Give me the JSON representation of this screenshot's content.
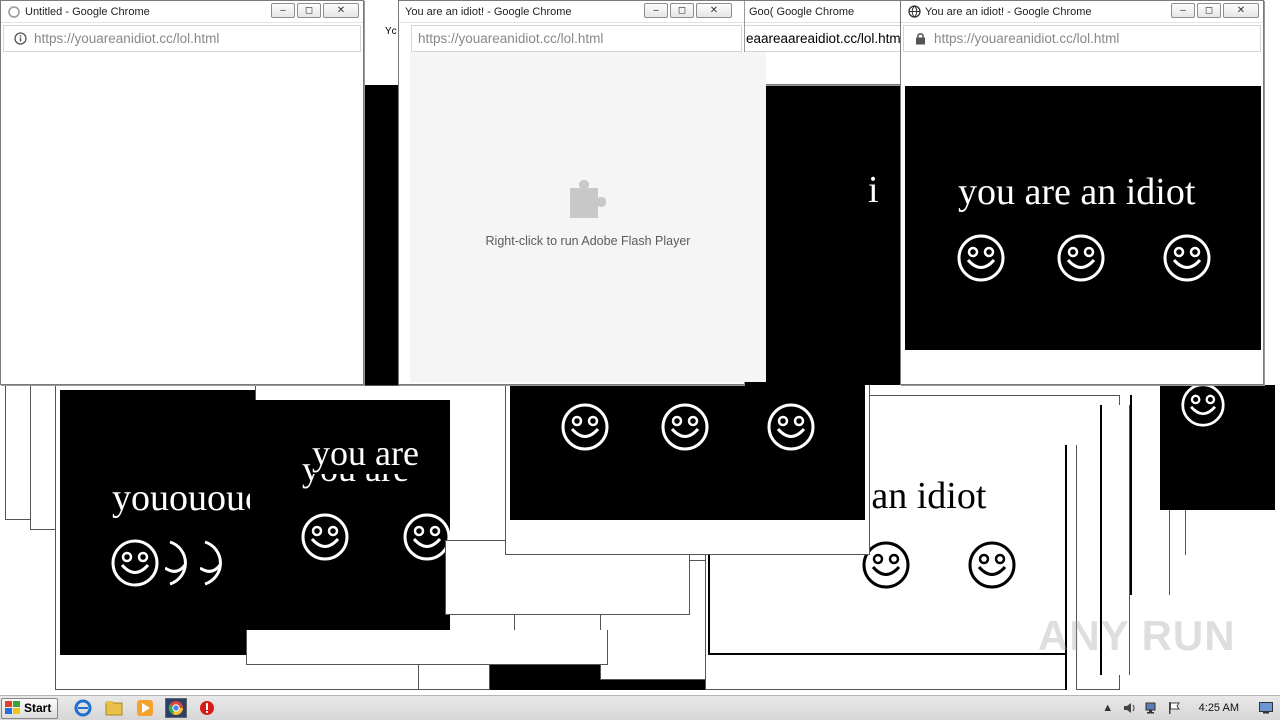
{
  "windows": {
    "untitled": {
      "title": "Untitled - Google Chrome",
      "url_host": "https://youareanidiot.cc",
      "url_path": "/lol.html"
    },
    "flash": {
      "title": "You are an idiot! - Google Chrome",
      "url_host": "https://youareanidiot.cc",
      "url_path": "/lol.html",
      "flash_message": "Right-click to run Adobe Flash Player"
    },
    "top_right": {
      "title": "You are an idiot! - Google Chrome",
      "url_host": "https://youareanidiot.cc",
      "url_path": "/lol.html",
      "heading": "you are an idiot"
    },
    "behind_top": {
      "title_left": "Goo( Google Chrome",
      "url_fragment": "eaareaareaidiot.cc/lol.htm",
      "fragment_text": "Yc"
    }
  },
  "background_texts": {
    "center_idiot": "idiot",
    "bottom_right_idiot": "e an idiot",
    "left_you": "youououc",
    "middle_you": "you are",
    "middle_you_shadow": "you are",
    "right_fragment": "i"
  },
  "window_controls": {
    "minimize": "–",
    "restore": "◻",
    "close": "✕"
  },
  "taskbar": {
    "start_label": "Start",
    "clock": "4:25 AM"
  },
  "watermark": "ANY RUN",
  "colors": {
    "panel": "#000000",
    "text": "#ffffff",
    "flash_bg": "#f5f5f5"
  }
}
